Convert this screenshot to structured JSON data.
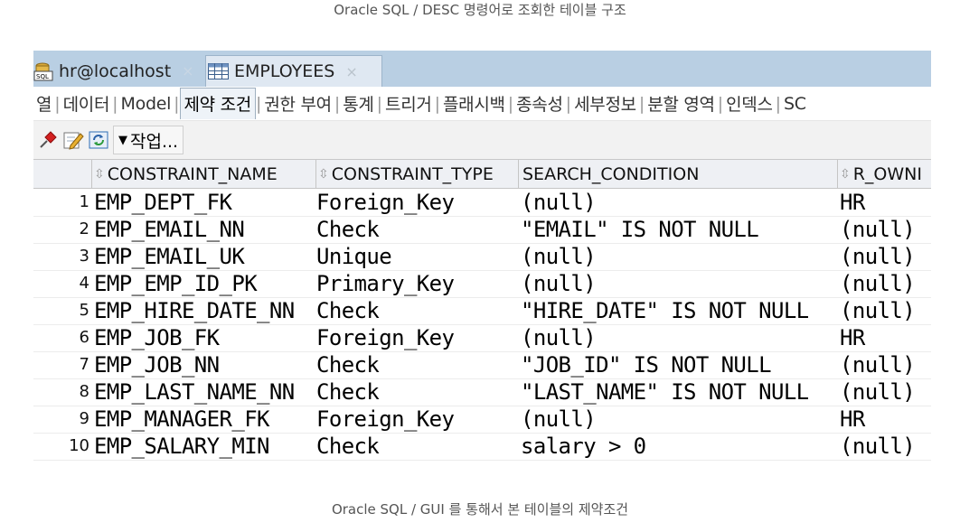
{
  "captions": {
    "top": "Oracle SQL / DESC 명령어로 조회한 테이블 구조",
    "bottom": "Oracle SQL / GUI 를 통해서 본 테이블의 제약조건"
  },
  "doc_tabs": [
    {
      "label": "hr@localhost",
      "icon": "sql-connection-icon",
      "close": "×"
    },
    {
      "label": "EMPLOYEES",
      "icon": "table-grid-icon",
      "close": "×"
    }
  ],
  "sub_tabs": [
    "열",
    "데이터",
    "Model",
    "제약 조건",
    "권한 부여",
    "통계",
    "트리거",
    "플래시백",
    "종속성",
    "세부정보",
    "분할 영역",
    "인덱스",
    "SC"
  ],
  "active_sub_tab": "제약 조건",
  "toolbar": {
    "icons": [
      "pin-icon",
      "edit-icon",
      "refresh-icon"
    ],
    "actions_label": "작업..."
  },
  "columns": [
    "CONSTRAINT_NAME",
    "CONSTRAINT_TYPE",
    "SEARCH_CONDITION",
    "R_OWNI"
  ],
  "rows": [
    {
      "n": "1",
      "name": "EMP_DEPT_FK",
      "type": "Foreign_Key",
      "cond": "(null)",
      "owner": "HR"
    },
    {
      "n": "2",
      "name": "EMP_EMAIL_NN",
      "type": "Check",
      "cond": "\"EMAIL\" IS NOT NULL",
      "owner": "(null)"
    },
    {
      "n": "3",
      "name": "EMP_EMAIL_UK",
      "type": "Unique",
      "cond": "(null)",
      "owner": "(null)"
    },
    {
      "n": "4",
      "name": "EMP_EMP_ID_PK",
      "type": "Primary_Key",
      "cond": "(null)",
      "owner": "(null)"
    },
    {
      "n": "5",
      "name": "EMP_HIRE_DATE_NN",
      "type": "Check",
      "cond": "\"HIRE_DATE\" IS NOT NULL",
      "owner": "(null)"
    },
    {
      "n": "6",
      "name": "EMP_JOB_FK",
      "type": "Foreign_Key",
      "cond": "(null)",
      "owner": "HR"
    },
    {
      "n": "7",
      "name": "EMP_JOB_NN",
      "type": "Check",
      "cond": "\"JOB_ID\" IS NOT NULL",
      "owner": "(null)"
    },
    {
      "n": "8",
      "name": "EMP_LAST_NAME_NN",
      "type": "Check",
      "cond": "\"LAST_NAME\" IS NOT NULL",
      "owner": "(null)"
    },
    {
      "n": "9",
      "name": "EMP_MANAGER_FK",
      "type": "Foreign_Key",
      "cond": "(null)",
      "owner": "HR"
    },
    {
      "n": "10",
      "name": "EMP_SALARY_MIN",
      "type": "Check",
      "cond": "salary > 0",
      "owner": "(null)"
    }
  ]
}
